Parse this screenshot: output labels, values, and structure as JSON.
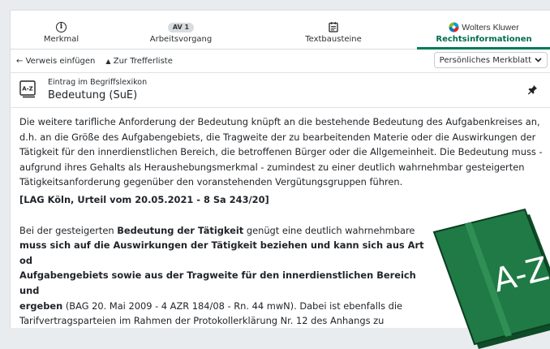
{
  "tabs": [
    {
      "label": "Merkmal",
      "icon": "info-icon"
    },
    {
      "label": "Arbeitsvorgang",
      "badge": "AV 1"
    },
    {
      "label": "Textbausteine",
      "icon": "text-template-icon"
    },
    {
      "label": "Rechtsinformationen",
      "brand": "Wolters Kluwer",
      "active": true
    }
  ],
  "toolbar": {
    "insert_reference": "Verweis einfügen",
    "to_results": "Zur Trefferliste",
    "personal_sheet": "Persönliches Merkblatt"
  },
  "entry": {
    "kicker": "Eintrag im Begriffslexikon",
    "title": "Bedeutung (SuE)",
    "icon_text": "A-Z"
  },
  "content": {
    "paragraph1": "Die weitere tarifliche Anforderung der Bedeutung knüpft an die bestehende Bedeutung des Aufgabenkreises an, d.h. an die Größe des Aufgabengebiets, die Tragweite der zu bearbeitenden Materie oder die Auswirkungen der Tätigkeit für den innerdienstlichen Bereich, die betroffenen Bürger oder die Allgemeinheit. Die Bedeutung muss - aufgrund ihres Gehalts als Heraushebungsmerkmal - zumindest zu einer deutlich wahrnehmbar gesteigerten Tätigkeitsanforderung gegenüber den voranstehenden Vergütungsgruppen führen.",
    "reference": "[LAG Köln, Urteil vom 20.05.2021 - 8 Sa 243/20]",
    "p2_intro": "Bei der gesteigerten ",
    "p2_bold1": "Bedeutung der Tätigkeit",
    "p2_mid": " genügt eine deutlich wahrnehmbare",
    "p2_bold2": "muss sich auf die Auswirkungen der Tätigkeit beziehen und kann sich aus Art od",
    "p2_bold3": "Aufgabengebiets sowie aus der Tragweite für den innerdienstlichen Bereich und",
    "p2_bold4": "ergeben",
    "p2_cite": " (BAG 20. Mai 2009 - 4 AZR 184/08 - Rn. 44 mwN). Dabei ist ebenfalls die",
    "p2_last": "Tarifvertragsparteien im Rahmen der Protokollerklärung Nr. 12 des Anhangs zu"
  },
  "decoration": {
    "book_text": "A-Z"
  },
  "colors": {
    "accent": "#007a5a",
    "book_green": "#1f7a45"
  }
}
